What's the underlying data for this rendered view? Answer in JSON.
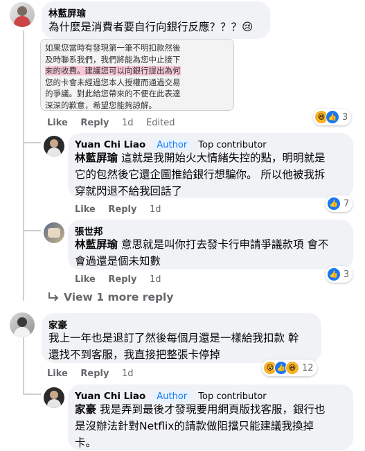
{
  "comments": [
    {
      "name": "林藍屏瑜",
      "text": "為什麼是消費者要自行向銀行反應？？？😢",
      "screenshot": {
        "lines": [
          "如果您當時有發現第一筆不明扣款然後",
          "及時聯系我們，我們將能為您中止接下",
          "來的收費。建議您可以向銀行提出為何",
          "您的卡會未經過您本人授權而通過交易",
          "的爭議。對此給您帶來的不便在此表達",
          "深深的歉意，希望您能夠諒解。"
        ]
      },
      "like": "Like",
      "reply": "Reply",
      "time": "1d",
      "edited": "Edited",
      "reaction_count": "3"
    },
    {
      "name": "Yuan Chi Liao",
      "author_badge": "Author",
      "top_badge": "Top contributor",
      "mention": "林藍屏瑜",
      "text_l1": "這就是我開始火大情緒失控的點，明明就是",
      "text_l2": "它的包然後它還企圖推給銀行想騙你。 所以他被我拆",
      "text_l3": "穿就閃退不給我回話了",
      "like": "Like",
      "reply": "Reply",
      "time": "1d",
      "reaction_count": "7"
    },
    {
      "name": "張世邦",
      "mention": "林藍屏瑜",
      "text_l1": "意思就是叫你打去發卡行申請爭議款項 會不",
      "text_l2": "會過還是個未知數",
      "like": "Like",
      "reply": "Reply",
      "time": "1d",
      "reaction_count": "3"
    },
    {
      "view_more": "View 1 more reply"
    },
    {
      "name": "家豪",
      "text_l1": "我上一年也是退訂了然後每個月還是一樣給我扣款 幹",
      "text_l2": "還找不到客服，我直接把整張卡停掉",
      "like": "Like",
      "reply": "Reply",
      "time": "1d",
      "reaction_count": "12"
    },
    {
      "name": "Yuan Chi Liao",
      "author_badge": "Author",
      "top_badge": "Top contributor",
      "mention": "家豪",
      "text_l1": "我是弄到最後才發現要用網頁版找客服，銀行也",
      "text_l2": "是沒辦法針對Netflix的請款做阻擋只能建議我換掉",
      "text_l3": "卡。"
    }
  ],
  "colors": {
    "bubble": "#f0f2f5",
    "accent": "#1877f2",
    "meta": "#65676b"
  }
}
